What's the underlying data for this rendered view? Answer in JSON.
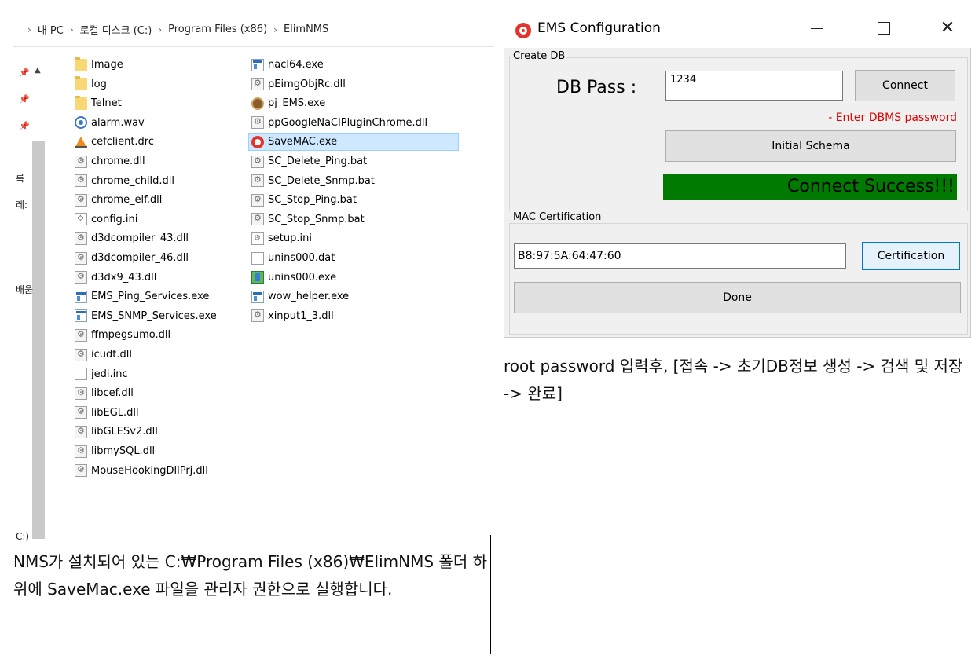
{
  "explorer": {
    "breadcrumb": [
      "내 PC",
      "로컬 디스크 (C:)",
      "Program Files (x86)",
      "ElimNMS"
    ],
    "nav_labels": [
      "룩",
      "레:",
      "배움",
      "C:)"
    ],
    "files_col1": [
      {
        "name": "Image",
        "icon": "folder-icon"
      },
      {
        "name": "log",
        "icon": "folder-icon"
      },
      {
        "name": "Telnet",
        "icon": "folder-icon"
      },
      {
        "name": "alarm.wav",
        "icon": "audio-file-icon"
      },
      {
        "name": "cefclient.drc",
        "icon": "vlc-cone-icon"
      },
      {
        "name": "chrome.dll",
        "icon": "dll-gear-icon"
      },
      {
        "name": "chrome_child.dll",
        "icon": "dll-gear-icon"
      },
      {
        "name": "chrome_elf.dll",
        "icon": "dll-gear-icon"
      },
      {
        "name": "config.ini",
        "icon": "ini-settings-icon"
      },
      {
        "name": "d3dcompiler_43.dll",
        "icon": "dll-gear-icon"
      },
      {
        "name": "d3dcompiler_46.dll",
        "icon": "dll-gear-icon"
      },
      {
        "name": "d3dx9_43.dll",
        "icon": "dll-gear-icon"
      },
      {
        "name": "EMS_Ping_Services.exe",
        "icon": "exe-window-icon"
      },
      {
        "name": "EMS_SNMP_Services.exe",
        "icon": "exe-window-icon"
      },
      {
        "name": "ffmpegsumo.dll",
        "icon": "dll-gear-icon"
      },
      {
        "name": "icudt.dll",
        "icon": "dll-gear-icon"
      },
      {
        "name": "jedi.inc",
        "icon": "blank-document-icon"
      },
      {
        "name": "libcef.dll",
        "icon": "dll-gear-icon"
      },
      {
        "name": "libEGL.dll",
        "icon": "dll-gear-icon"
      },
      {
        "name": "libGLESv2.dll",
        "icon": "dll-gear-icon"
      },
      {
        "name": "libmySQL.dll",
        "icon": "dll-gear-icon"
      },
      {
        "name": "MouseHookingDllPrj.dll",
        "icon": "dll-gear-icon"
      }
    ],
    "files_col2": [
      {
        "name": "nacl64.exe",
        "icon": "exe-window-icon"
      },
      {
        "name": "pEimgObjRc.dll",
        "icon": "dll-gear-icon"
      },
      {
        "name": "pj_EMS.exe",
        "icon": "pj-app-icon"
      },
      {
        "name": "ppGoogleNaClPluginChrome.dll",
        "icon": "dll-gear-icon"
      },
      {
        "name": "SaveMAC.exe",
        "icon": "ems-app-icon",
        "selected": true
      },
      {
        "name": "SC_Delete_Ping.bat",
        "icon": "batch-gear-icon"
      },
      {
        "name": "SC_Delete_Snmp.bat",
        "icon": "batch-gear-icon"
      },
      {
        "name": "SC_Stop_Ping.bat",
        "icon": "batch-gear-icon"
      },
      {
        "name": "SC_Stop_Snmp.bat",
        "icon": "batch-gear-icon"
      },
      {
        "name": "setup.ini",
        "icon": "ini-settings-icon"
      },
      {
        "name": "unins000.dat",
        "icon": "blank-document-icon"
      },
      {
        "name": "unins000.exe",
        "icon": "installer-icon"
      },
      {
        "name": "wow_helper.exe",
        "icon": "exe-window-icon"
      },
      {
        "name": "xinput1_3.dll",
        "icon": "dll-gear-icon"
      }
    ]
  },
  "caption_left": "NMS가 설치되어 있는 C:₩Program Files (x86)₩ElimNMS 폴더 하위에 SaveMac.exe 파일을 관리자 권한으로 실행합니다.",
  "dialog": {
    "title": "EMS Configuration",
    "create_db_group": "Create DB",
    "db_pass_label": "DB Pass :",
    "db_pass_value": "1234",
    "connect_label": "Connect",
    "db_hint": "- Enter DBMS password",
    "initial_schema_label": "Initial Schema",
    "connect_status": "Connect Success!!!",
    "status_color": "#007a00",
    "hint_color": "#e00000",
    "mac_group": "MAC Certification",
    "mac_value": "B8:97:5A:64:47:60",
    "certification_label": "Certification",
    "done_label": "Done"
  },
  "caption_right": "root password 입력후, [접속 -> 초기DB정보 생성 -> 검색 및 저장 -> 완료]"
}
